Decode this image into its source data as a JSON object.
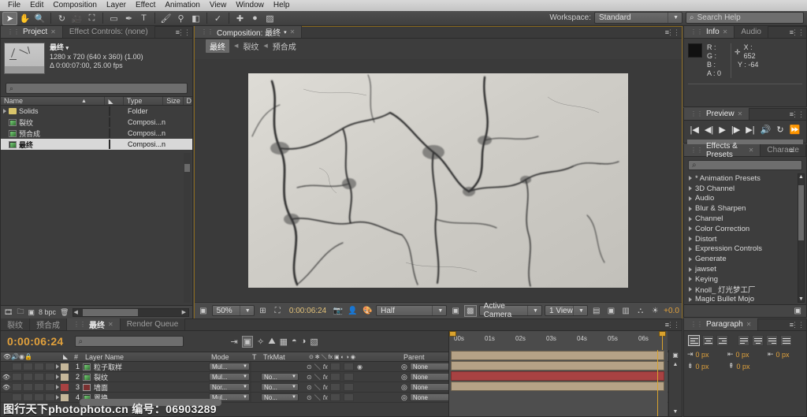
{
  "menubar": {
    "items": [
      "File",
      "Edit",
      "Composition",
      "Layer",
      "Effect",
      "Animation",
      "View",
      "Window",
      "Help"
    ]
  },
  "toolbar": {
    "workspace_label": "Workspace:",
    "workspace_value": "Standard",
    "search_placeholder": "Search Help",
    "tools": [
      "selection-tool",
      "hand-tool",
      "zoom-tool",
      "rotation-tool",
      "camera-tool",
      "pan-behind-tool",
      "shape-tool",
      "pen-tool",
      "type-tool",
      "brush-tool",
      "clone-stamp-tool",
      "eraser-tool",
      "roto-brush-tool",
      "puppet-pin-tool"
    ]
  },
  "project": {
    "tabs": [
      {
        "label": "Project",
        "active": true,
        "closable": true
      },
      {
        "label": "Effect Controls: (none)",
        "active": false,
        "closable": false
      }
    ],
    "item_name": "最终",
    "item_dim": "1280 x 720   (640 x 360) (1.00)",
    "item_dur": "Δ 0:00:07:00, 25.00 fps",
    "search_placeholder": "",
    "columns": [
      "Name",
      "Type",
      "Size",
      "D"
    ],
    "rows": [
      {
        "name": "Solids",
        "type": "Folder",
        "size": "",
        "icon": "folder-icon",
        "swatch": "#d9c46a",
        "selected": false,
        "expandable": true
      },
      {
        "name": "裂纹",
        "type": "Composi...n",
        "size": "",
        "icon": "composition-icon",
        "swatch": "#b5a286",
        "selected": false,
        "expandable": false
      },
      {
        "name": "预合成",
        "type": "Composi...n",
        "size": "",
        "icon": "composition-icon",
        "swatch": "#b5a286",
        "selected": false,
        "expandable": false
      },
      {
        "name": "最终",
        "type": "Composi...n",
        "size": "",
        "icon": "composition-icon",
        "swatch": "#c5b79a",
        "selected": true,
        "expandable": false
      }
    ],
    "footer_bpc": "8 bpc"
  },
  "composition": {
    "tab_label": "Composition: 最终",
    "breadcrumb": [
      "最终",
      "裂纹",
      "预合成"
    ],
    "zoom": "50%",
    "timecode": "0:00:06:24",
    "resolution": "Half",
    "camera": "Active Camera",
    "views": "1 View",
    "exposure": "+0.0"
  },
  "info": {
    "tabs": [
      "Info",
      "Audio"
    ],
    "r": "R :",
    "g": "G :",
    "b": "B :",
    "a": "A : 0",
    "x": "X : 652",
    "y": "Y : -64"
  },
  "preview": {
    "tab": "Preview",
    "buttons": [
      "first-frame",
      "previous-frame",
      "play",
      "next-frame",
      "last-frame",
      "audio",
      "loop",
      "ram-preview"
    ]
  },
  "effects": {
    "tabs": [
      "Effects & Presets",
      "Characte"
    ],
    "search_placeholder": "",
    "items": [
      "* Animation Presets",
      "3D Channel",
      "Audio",
      "Blur & Sharpen",
      "Channel",
      "Color Correction",
      "Distort",
      "Expression Controls",
      "Generate",
      "jawset",
      "Keying",
      "Knoll_ 灯光梦工厂",
      "Magic Bullet Mojo"
    ]
  },
  "paragraph": {
    "tab": "Paragraph",
    "align_buttons": [
      "align-left",
      "align-center",
      "align-right",
      "justify-last-left",
      "justify-last-center",
      "justify-last-right",
      "justify-all"
    ],
    "indents": [
      {
        "name": "indent-left",
        "value": "0 px"
      },
      {
        "name": "indent-first-line",
        "value": "0 px"
      },
      {
        "name": "indent-right",
        "value": "0 px"
      },
      {
        "name": "space-before",
        "value": "0 px"
      },
      {
        "name": "space-after",
        "value": "0 px"
      }
    ]
  },
  "timeline": {
    "tabs": [
      {
        "label": "裂纹",
        "active": false
      },
      {
        "label": "预合成",
        "active": false
      },
      {
        "label": "最终",
        "active": true
      },
      {
        "label": "Render Queue",
        "active": false
      }
    ],
    "timecode": "0:00:06:24",
    "search_placeholder": "",
    "ruler_ticks": [
      "00s",
      "01s",
      "02s",
      "03s",
      "04s",
      "05s",
      "06s"
    ],
    "columns": [
      "Layer Name",
      "Mode",
      "T",
      "TrkMat",
      "Parent"
    ],
    "layers": [
      {
        "num": "1",
        "name": "粒子取样",
        "mode": "Mul...",
        "trkmat": "",
        "parent": "None",
        "label": "#c5b79a",
        "bar": "tan",
        "visible": false
      },
      {
        "num": "2",
        "name": "裂纹",
        "mode": "Mul...",
        "trkmat": "No...",
        "parent": "None",
        "label": "#c5b79a",
        "bar": "tan",
        "visible": true
      },
      {
        "num": "3",
        "name": "墙面",
        "mode": "Nor...",
        "trkmat": "No...",
        "parent": "None",
        "label": "#a84242",
        "bar": "red",
        "visible": true
      },
      {
        "num": "4",
        "name": "置换",
        "mode": "Mul...",
        "trkmat": "No...",
        "parent": "None",
        "label": "#c5b79a",
        "bar": "tan",
        "visible": false
      }
    ]
  },
  "watermark": "图行天下photophoto.cn  编号：06903289"
}
